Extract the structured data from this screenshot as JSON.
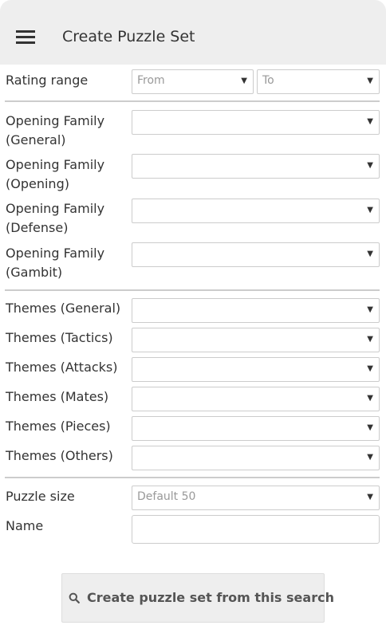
{
  "header": {
    "title": "Create Puzzle Set",
    "menu_icon": "hamburger-menu-icon"
  },
  "rating": {
    "label": "Rating range",
    "from": "From",
    "to": "To"
  },
  "openings": [
    {
      "label_line1": "Opening Family",
      "label_line2": "(General)",
      "value": ""
    },
    {
      "label_line1": "Opening Family",
      "label_line2": "(Opening)",
      "value": ""
    },
    {
      "label_line1": "Opening Family",
      "label_line2": "(Defense)",
      "value": ""
    },
    {
      "label_line1": "Opening Family",
      "label_line2": "(Gambit)",
      "value": ""
    }
  ],
  "themes": [
    {
      "label": "Themes (General)",
      "value": ""
    },
    {
      "label": "Themes (Tactics)",
      "value": ""
    },
    {
      "label": "Themes (Attacks)",
      "value": ""
    },
    {
      "label": "Themes (Mates)",
      "value": ""
    },
    {
      "label": "Themes (Pieces)",
      "value": ""
    },
    {
      "label": "Themes (Others)",
      "value": ""
    }
  ],
  "puzzle_size": {
    "label": "Puzzle size",
    "value": "Default 50"
  },
  "name": {
    "label": "Name",
    "value": ""
  },
  "submit": {
    "label": "Create puzzle set from this search",
    "icon": "search-icon"
  },
  "arrow": "▼"
}
